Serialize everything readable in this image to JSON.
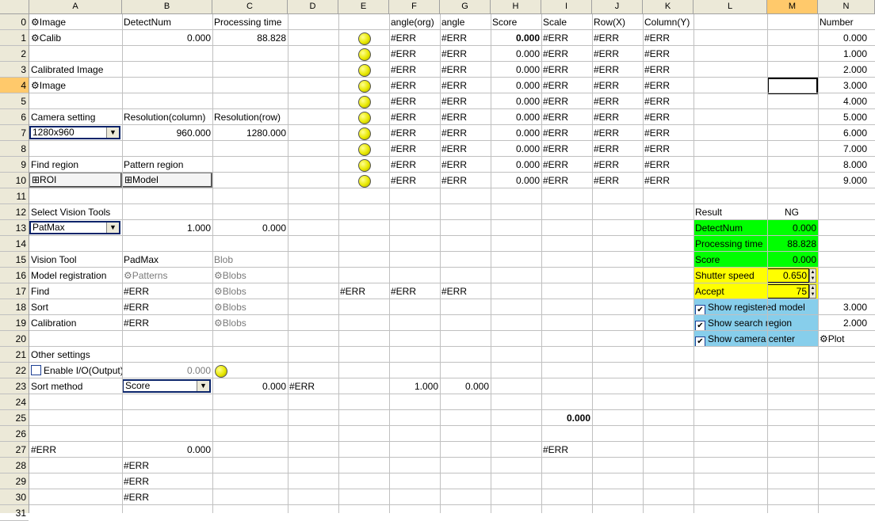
{
  "columns": [
    "A",
    "B",
    "C",
    "D",
    "E",
    "F",
    "G",
    "H",
    "I",
    "J",
    "K",
    "L",
    "M",
    "N"
  ],
  "rows": [
    "0",
    "1",
    "2",
    "3",
    "4",
    "5",
    "6",
    "7",
    "8",
    "9",
    "10",
    "11",
    "12",
    "13",
    "14",
    "15",
    "16",
    "17",
    "18",
    "19",
    "20",
    "21",
    "22",
    "23",
    "24",
    "25",
    "26",
    "27",
    "28",
    "29",
    "30",
    "31"
  ],
  "header_row": {
    "image": "⚙Image",
    "detect_num": "DetectNum",
    "processing_time": "Processing time",
    "angle_org": "angle(org)",
    "angle": "angle",
    "score": "Score",
    "scale": "Scale",
    "row_x": "Row(X)",
    "column_y": "Column(Y)",
    "number": "Number"
  },
  "calib_row": {
    "label": "⚙Calib",
    "detect": "0.000",
    "time": "88.828"
  },
  "result_table": [
    {
      "angle_org": "#ERR",
      "angle": "#ERR",
      "score": "0.000",
      "scale": "#ERR",
      "row": "#ERR",
      "col": "#ERR",
      "num": "0.000"
    },
    {
      "angle_org": "#ERR",
      "angle": "#ERR",
      "score": "0.000",
      "scale": "#ERR",
      "row": "#ERR",
      "col": "#ERR",
      "num": "1.000"
    },
    {
      "angle_org": "#ERR",
      "angle": "#ERR",
      "score": "0.000",
      "scale": "#ERR",
      "row": "#ERR",
      "col": "#ERR",
      "num": "2.000"
    },
    {
      "angle_org": "#ERR",
      "angle": "#ERR",
      "score": "0.000",
      "scale": "#ERR",
      "row": "#ERR",
      "col": "#ERR",
      "num": "3.000"
    },
    {
      "angle_org": "#ERR",
      "angle": "#ERR",
      "score": "0.000",
      "scale": "#ERR",
      "row": "#ERR",
      "col": "#ERR",
      "num": "4.000"
    },
    {
      "angle_org": "#ERR",
      "angle": "#ERR",
      "score": "0.000",
      "scale": "#ERR",
      "row": "#ERR",
      "col": "#ERR",
      "num": "5.000"
    },
    {
      "angle_org": "#ERR",
      "angle": "#ERR",
      "score": "0.000",
      "scale": "#ERR",
      "row": "#ERR",
      "col": "#ERR",
      "num": "6.000"
    },
    {
      "angle_org": "#ERR",
      "angle": "#ERR",
      "score": "0.000",
      "scale": "#ERR",
      "row": "#ERR",
      "col": "#ERR",
      "num": "7.000"
    },
    {
      "angle_org": "#ERR",
      "angle": "#ERR",
      "score": "0.000",
      "scale": "#ERR",
      "row": "#ERR",
      "col": "#ERR",
      "num": "8.000"
    },
    {
      "angle_org": "#ERR",
      "angle": "#ERR",
      "score": "0.000",
      "scale": "#ERR",
      "row": "#ERR",
      "col": "#ERR",
      "num": "9.000"
    }
  ],
  "left": {
    "calibrated_image": "Calibrated Image",
    "image_btn": "⚙Image",
    "camera_setting": "Camera setting",
    "resolution_column": "Resolution(column)",
    "resolution_row": "Resolution(row)",
    "resolution_combo": "1280x960",
    "res_col_val": "960.000",
    "res_row_val": "1280.000",
    "find_region": "Find region",
    "pattern_region": "Pattern region",
    "roi_btn": "⊞ROI",
    "model_btn": "⊞Model",
    "select_vision_tools": "Select Vision Tools",
    "vision_combo": "PatMax",
    "tool_val1": "1.000",
    "tool_val2": "0.000",
    "vision_tool": "Vision Tool",
    "padmax": "PadMax",
    "blob": "Blob",
    "model_registration": "Model registration",
    "patterns": "⚙Patterns",
    "blobs": "⚙Blobs",
    "find": "Find",
    "sort": "Sort",
    "calibration": "Calibration",
    "err": "#ERR",
    "other_settings": "Other settings",
    "enable_io": "Enable I/O(Output)",
    "enable_io_val": "0.000",
    "sort_method": "Sort method",
    "sort_combo": "Score",
    "sort_val": "0.000",
    "sort_err": "#ERR",
    "sort_f": "1.000",
    "sort_g": "0.000",
    "i25": "0.000",
    "a27": "#ERR",
    "b27": "0.000",
    "i27": "#ERR"
  },
  "result_panel": {
    "result_label": "Result",
    "result_value": "NG",
    "detect_num": "DetectNum",
    "detect_val": "0.000",
    "processing_time": "Processing time",
    "processing_val": "88.828",
    "score": "Score",
    "score_val": "0.000",
    "shutter_speed": "Shutter speed",
    "shutter_val": "0.650",
    "accept": "Accept",
    "accept_val": "75",
    "show_registered": "Show registered model",
    "show_search": "Show search region",
    "show_camera": "Show camera center",
    "n18": "3.000",
    "n19": "2.000",
    "plot_btn": "⚙Plot"
  },
  "colors": {
    "green": "#00ff00",
    "yellow": "#ffff00",
    "blue_panel": "#87ceeb",
    "selected_col": "#ffc96b"
  }
}
